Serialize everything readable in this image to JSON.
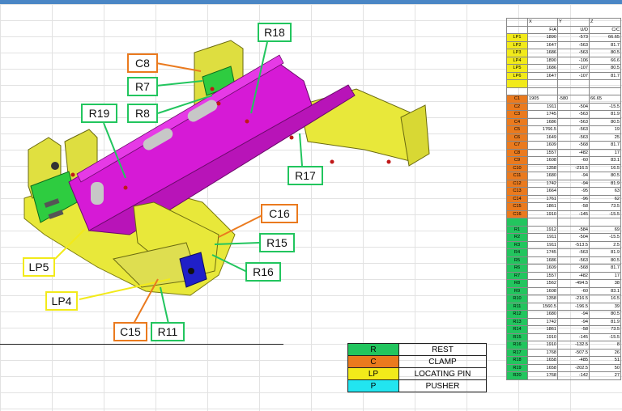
{
  "callouts": {
    "r18": "R18",
    "c8": "C8",
    "r7": "R7",
    "r8": "R8",
    "r19": "R19",
    "r17": "R17",
    "c16": "C16",
    "r15": "R15",
    "r16": "R16",
    "lp5": "LP5",
    "lp4": "LP4",
    "c15": "C15",
    "r11": "R11"
  },
  "table": {
    "axis_row": [
      "",
      "X",
      "Y",
      "Z"
    ],
    "header_row": [
      "",
      "F/A",
      "U/D",
      "C/C"
    ],
    "lp_rows": [
      [
        "LP1",
        "1890",
        "-573",
        "66.65"
      ],
      [
        "LP2",
        "1647",
        "-563",
        "81.7"
      ],
      [
        "LP3",
        "1686",
        "-563",
        "80.5"
      ],
      [
        "LP4",
        "1890",
        "-106",
        "66.6"
      ],
      [
        "LP5",
        "1686",
        "-107",
        "80.5"
      ],
      [
        "LP6",
        "1647",
        "-107",
        "81.7"
      ]
    ],
    "c_rows": [
      [
        "C1",
        "1905",
        "-580",
        "66.65"
      ],
      [
        "C2",
        "1911",
        "-504",
        "-15.5"
      ],
      [
        "C3",
        "1745",
        "-563",
        "81.9"
      ],
      [
        "C4",
        "1686",
        "-563",
        "80.5"
      ],
      [
        "C5",
        "1766.5",
        "-563",
        "19"
      ],
      [
        "C6",
        "1649",
        "-563",
        "25"
      ],
      [
        "C7",
        "1609",
        "-568",
        "81.7"
      ],
      [
        "C8",
        "1557",
        "-482",
        "17"
      ],
      [
        "C9",
        "1608",
        "-60",
        "83.1"
      ],
      [
        "C10",
        "1358",
        "-216.5",
        "16.5"
      ],
      [
        "C11",
        "1680",
        "-94",
        "80.5"
      ],
      [
        "C12",
        "1742",
        "-94",
        "81.9"
      ],
      [
        "C13",
        "1664",
        "-95",
        "63"
      ],
      [
        "C14",
        "1761",
        "-96",
        "62"
      ],
      [
        "C15",
        "1861",
        "-58",
        "73.5"
      ],
      [
        "C16",
        "1910",
        "-145",
        "-15.5"
      ]
    ],
    "r_rows": [
      [
        "R1",
        "1912",
        "-584",
        "69"
      ],
      [
        "R2",
        "1911",
        "-504",
        "-15.5"
      ],
      [
        "R3",
        "1911",
        "-513.5",
        "2.5"
      ],
      [
        "R4",
        "1745",
        "-563",
        "81.9"
      ],
      [
        "R5",
        "1686",
        "-563",
        "80.5"
      ],
      [
        "R6",
        "1609",
        "-568",
        "81.7"
      ],
      [
        "R7",
        "1557",
        "-482",
        "17"
      ],
      [
        "R8",
        "1562",
        "-494.5",
        "38"
      ],
      [
        "R9",
        "1608",
        "-60",
        "83.1"
      ],
      [
        "R10",
        "1358",
        "-216.5",
        "16.5"
      ],
      [
        "R11",
        "1560.5",
        "-196.5",
        "39"
      ],
      [
        "R12",
        "1680",
        "-94",
        "80.5"
      ],
      [
        "R13",
        "1742",
        "-94",
        "81.9"
      ],
      [
        "R14",
        "1861",
        "-58",
        "73.5"
      ],
      [
        "R15",
        "1910",
        "-145",
        "-15.5"
      ],
      [
        "R16",
        "1910",
        "-132.5",
        "8"
      ],
      [
        "R17",
        "1768",
        "-507.5",
        "26"
      ],
      [
        "R18",
        "1658",
        "-485",
        "51"
      ],
      [
        "R19",
        "1658",
        "-202.5",
        "50"
      ],
      [
        "R20",
        "1768",
        "-142",
        "27"
      ]
    ]
  },
  "legend": [
    {
      "code": "R",
      "label": "REST",
      "color": "#22c55e"
    },
    {
      "code": "C",
      "label": "CLAMP",
      "color": "#ea7a1e"
    },
    {
      "code": "LP",
      "label": "LOCATING PIN",
      "color": "#f2ea1a"
    },
    {
      "code": "P",
      "label": "PUSHER",
      "color": "#22e5f0"
    }
  ],
  "colors": {
    "rest": "#22c55e",
    "clamp": "#ea7a1e",
    "locating_pin": "#f2ea1a",
    "pusher": "#22e5f0",
    "part_magenta": "#d61ad6",
    "part_yellow": "#e8e83a"
  }
}
